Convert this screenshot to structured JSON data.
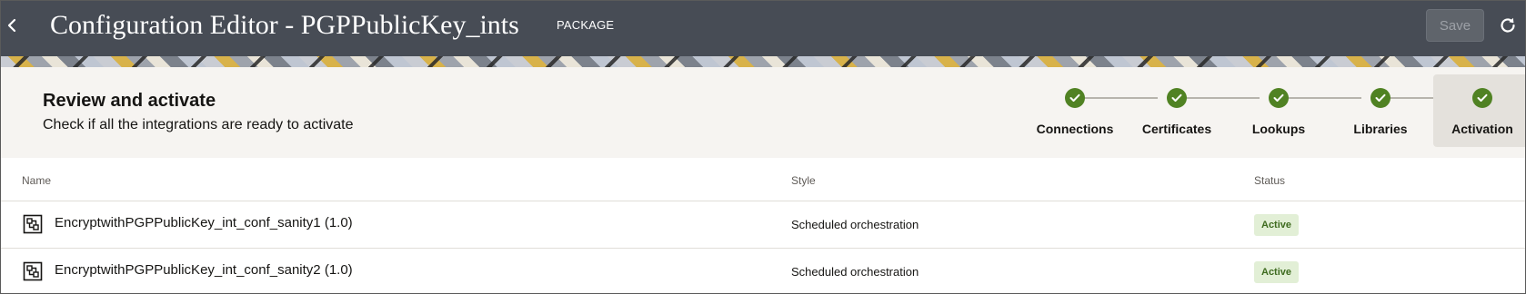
{
  "header": {
    "title": "Configuration Editor - PGPPublicKey_ints",
    "badge": "PACKAGE",
    "save_label": "Save"
  },
  "review": {
    "title": "Review and activate",
    "subtitle": "Check if all the integrations are ready to activate"
  },
  "steps": [
    {
      "label": "Connections",
      "complete": true
    },
    {
      "label": "Certificates",
      "complete": true
    },
    {
      "label": "Lookups",
      "complete": true
    },
    {
      "label": "Libraries",
      "complete": true
    },
    {
      "label": "Activation",
      "complete": true,
      "selected": true
    }
  ],
  "table": {
    "columns": [
      "Name",
      "Style",
      "Status"
    ],
    "rows": [
      {
        "name": "EncryptwithPGPPublicKey_int_conf_sanity1 (1.0)",
        "style": "Scheduled orchestration",
        "status": "Active",
        "icon": "integration-icon"
      },
      {
        "name": "EncryptwithPGPPublicKey_int_conf_sanity2 (1.0)",
        "style": "Scheduled orchestration",
        "status": "Active",
        "icon": "integration-icon"
      }
    ]
  },
  "colors": {
    "header_bg": "#474c55",
    "step_complete": "#508223",
    "status_active_bg": "#e2efd6",
    "status_active_text": "#3e6b1f"
  }
}
